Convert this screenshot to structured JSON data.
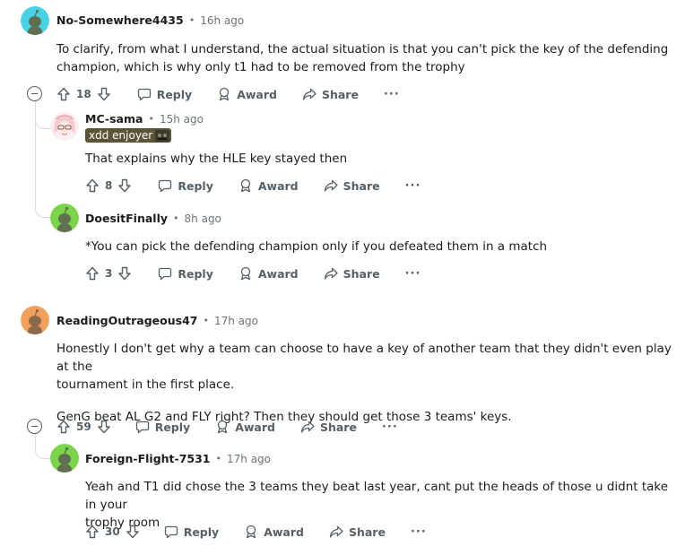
{
  "colors": {
    "snoo_teal": "#46d1e6",
    "snoo_green": "#7bd44a",
    "snoo_orange": "#f2a05c",
    "snoo_body": "#6b7a5a",
    "thread_line": "#d8dadc",
    "flair_bg": "#5b5436"
  },
  "action_labels": {
    "reply": "Reply",
    "award": "Award",
    "share": "Share",
    "more": "···"
  },
  "comments": [
    {
      "username": "No-Somewhere4435",
      "separator": "•",
      "time": "16h ago",
      "body_lines": [
        "To clarify, from what I understand, the actual situation is that you can't pick the key of the defending",
        "champion, which is why only t1 had to be removed from the trophy"
      ],
      "votes": "18",
      "avatar_icon": "snoo-avatar-icon"
    },
    {
      "username": "MC-sama",
      "separator": "•",
      "time": "15h ago",
      "flair": "xdd enjoyer",
      "body_lines": [
        "That explains why the HLE key stayed then"
      ],
      "votes": "8",
      "avatar_icon": "anime-avatar-icon"
    },
    {
      "username": "DoesitFinally",
      "separator": "•",
      "time": "8h ago",
      "body_lines": [
        "*You can pick the defending champion only if you defeated them in a match"
      ],
      "votes": "3",
      "avatar_icon": "snoo-avatar-icon"
    },
    {
      "username": "ReadingOutrageous47",
      "separator": "•",
      "time": "17h ago",
      "body_lines": [
        "Honestly I don't get why a team can choose to have a key of another team that they didn't even play at the",
        "tournament in the first place."
      ],
      "body_para2": "GenG beat AL G2 and FLY right? Then they should get those 3 teams' keys.",
      "votes": "59",
      "avatar_icon": "snoo-avatar-icon"
    },
    {
      "username": "Foreign-Flight-7531",
      "separator": "•",
      "time": "17h ago",
      "body_lines": [
        "Yeah and T1 did chose the 3 teams they beat last year, cant put the heads of those u didnt take in your",
        "trophy room"
      ],
      "votes": "30",
      "avatar_icon": "snoo-avatar-icon"
    }
  ]
}
